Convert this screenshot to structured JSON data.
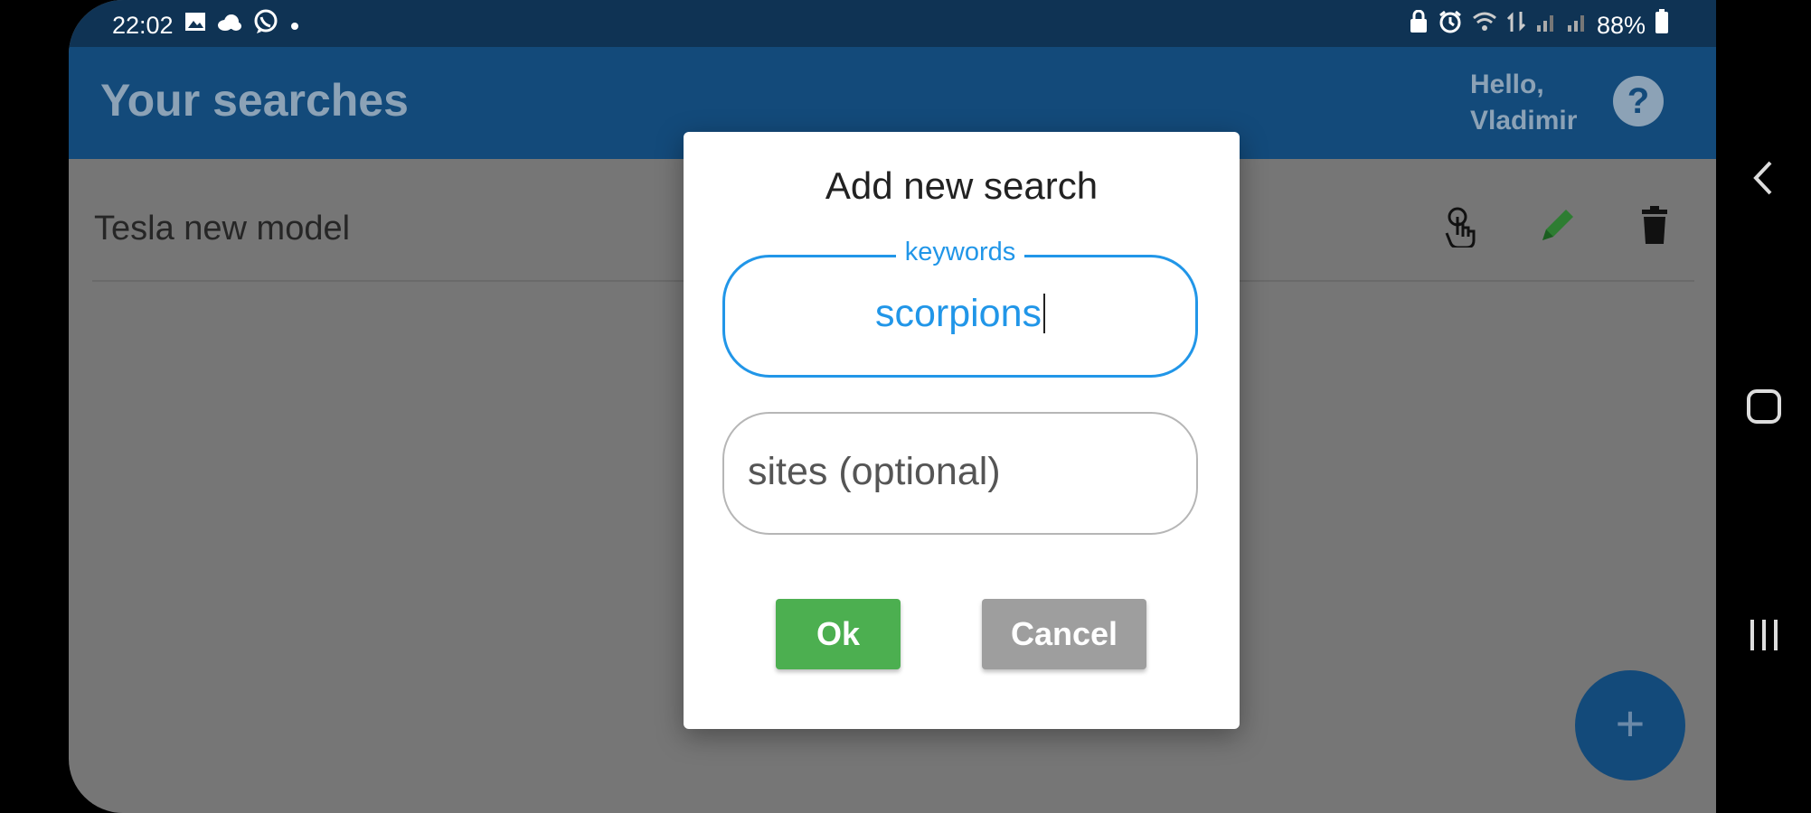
{
  "status_bar": {
    "time": "22:02",
    "battery": "88%",
    "left_icons": [
      "gallery-icon",
      "cloud-icon",
      "viber-icon",
      "dot-icon"
    ],
    "right_icons": [
      "lock-icon",
      "alarm-icon",
      "wifi-icon",
      "data-icon",
      "signal-icon",
      "signal-icon-2",
      "battery-icon"
    ]
  },
  "app_bar": {
    "title": "Your searches",
    "greeting": "Hello, Vladimir",
    "help_label": "?"
  },
  "list": {
    "items": [
      {
        "label": "Tesla new model"
      }
    ]
  },
  "dialog": {
    "title": "Add new search",
    "keywords": {
      "label": "keywords",
      "value": "scorpions"
    },
    "sites": {
      "placeholder": "sites (optional)"
    },
    "ok_label": "Ok",
    "cancel_label": "Cancel"
  },
  "fab": {
    "label": "+"
  },
  "colors": {
    "status_bar": "#0f3354",
    "app_bar": "#134a7a",
    "overlay_bg": "#767676",
    "accent": "#2196e8",
    "ok": "#4caf50",
    "cancel": "#9e9e9e"
  }
}
